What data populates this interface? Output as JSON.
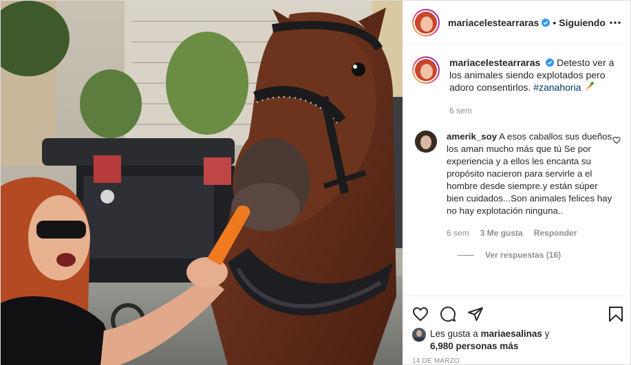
{
  "post": {
    "author": "mariacelestearraras",
    "follow_separator": "•",
    "follow_status": "Siguiendo",
    "more_icon": "more-horizontal-icon",
    "verified_icon": "verified-badge-icon"
  },
  "caption": {
    "username": "mariacelestearraras",
    "text": "Detesto ver a los animales siendo explotados pero adoro consentirlos.",
    "hashtag": "#zanahoria",
    "emoji": "carrot-emoji",
    "time": "6 sem"
  },
  "comment": {
    "username": "amerik_soy",
    "text": "A esos caballos sus dueños los aman mucho más que tú Se por experiencia y a ellos les encanta su propósito nacieron para servirle a el hombre desde siempre.y están súper bien cuidados...Son animales felices hay no hay explotación ninguna..",
    "time": "6 sem",
    "likes": "3 Me gusta",
    "reply": "Responder",
    "view_replies": "Ver respuestas (16)"
  },
  "actions": {
    "like_icon": "heart-icon",
    "comment_icon": "comment-icon",
    "share_icon": "paper-plane-icon",
    "save_icon": "bookmark-icon"
  },
  "likes": {
    "prefix": "Les gusta a",
    "user": "mariaesalinas",
    "connector": "y",
    "others": "6,980 personas más"
  },
  "date": "14 DE MARZO",
  "colors": {
    "verified": "#3897f0",
    "hashtag": "#00376b",
    "muted": "#8e8e8e",
    "text": "#262626",
    "border": "#efefef"
  }
}
